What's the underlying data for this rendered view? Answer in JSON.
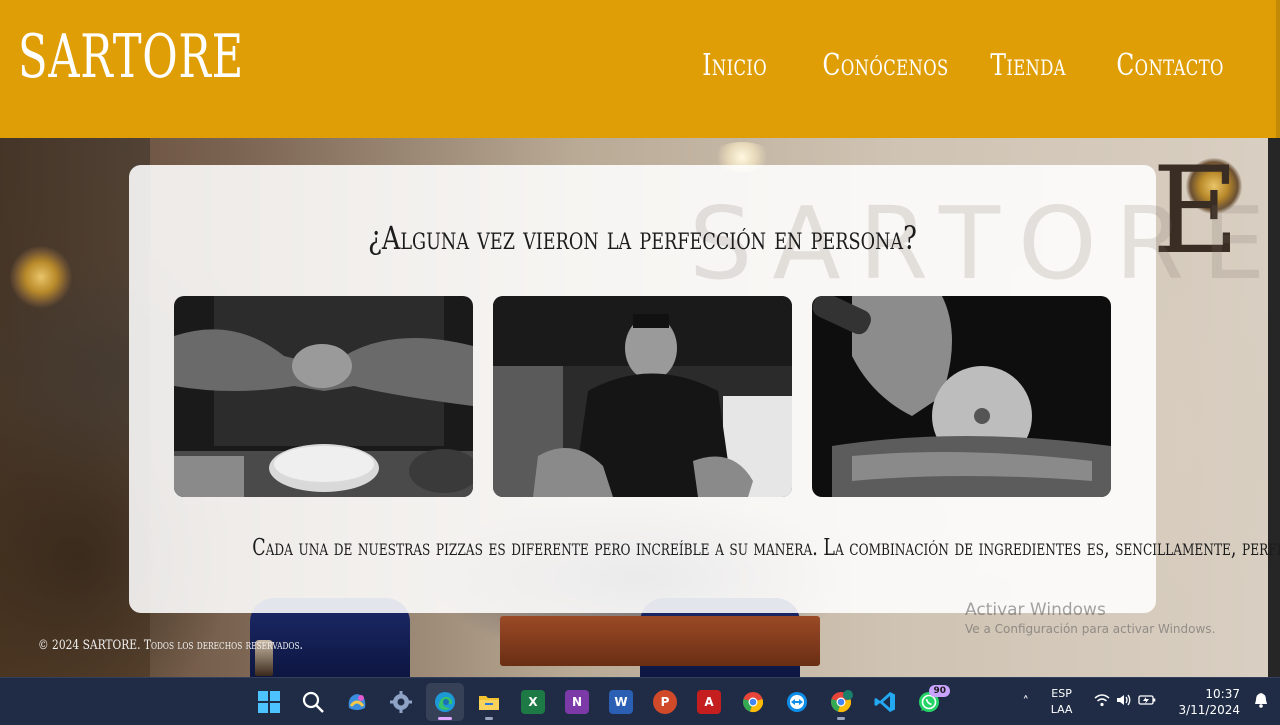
{
  "header": {
    "brand": "SARTORE",
    "nav": [
      {
        "label": "Inicio"
      },
      {
        "label": "Conócenos"
      },
      {
        "label": "Tienda"
      },
      {
        "label": "Contacto"
      }
    ],
    "background_color": "#e09e06"
  },
  "card": {
    "heading": "¿Alguna vez vieron la perfección en persona?",
    "images": [
      {
        "alt": "Manos espolvoreando harina sobre masa"
      },
      {
        "alt": "Pizzero sonriendo mientras prepara la masa"
      },
      {
        "alt": "Cortador de pizza sobre una pizza"
      }
    ],
    "tagline": "Cada una de nuestras pizzas es diferente pero increíble a su manera. La combinación de ingredientes es, sencillamente, perfecta."
  },
  "footer": {
    "copyright": "© 2024 SARTORE. Todos los derechos reservados."
  },
  "windows_watermark": {
    "title": "Activar Windows",
    "subtitle": "Ve a Configuración para activar Windows."
  },
  "taskbar": {
    "apps": [
      {
        "name": "start-icon"
      },
      {
        "name": "search-icon"
      },
      {
        "name": "copilot-icon"
      },
      {
        "name": "settings-icon"
      },
      {
        "name": "edge-icon",
        "active": true
      },
      {
        "name": "file-explorer-icon"
      },
      {
        "name": "excel-icon"
      },
      {
        "name": "onenote-icon"
      },
      {
        "name": "word-icon"
      },
      {
        "name": "powerpoint-icon"
      },
      {
        "name": "acrobat-icon"
      },
      {
        "name": "chrome-icon"
      },
      {
        "name": "teamviewer-icon"
      },
      {
        "name": "chrome-profile-icon"
      },
      {
        "name": "vscode-icon"
      },
      {
        "name": "whatsapp-icon",
        "badge": "90"
      }
    ],
    "tray": {
      "lang_top": "ESP",
      "lang_bottom": "LAA",
      "time": "10:37",
      "date": "3/11/2024"
    }
  },
  "colors": {
    "accent": "#e09e06",
    "taskbar": "#202c46"
  }
}
